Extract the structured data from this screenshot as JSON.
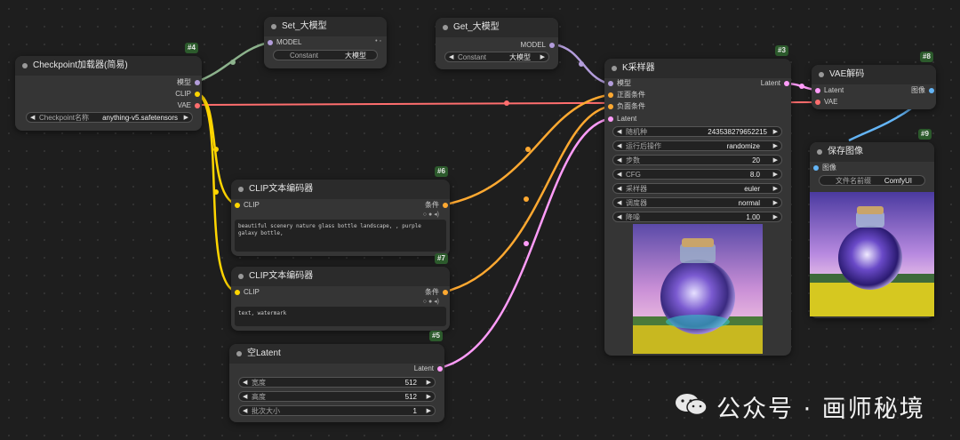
{
  "nodes": {
    "checkpoint": {
      "id": "#4",
      "title": "Checkpoint加载器(简易)",
      "outputs": [
        "模型",
        "CLIP",
        "VAE"
      ],
      "widget_label": "Checkpoint名称",
      "widget_value": "anything-v5.safetensors"
    },
    "set_model": {
      "title": "Set_大模型",
      "input": "MODEL",
      "widget_label": "Constant",
      "widget_value": "大模型"
    },
    "get_model": {
      "title": "Get_大模型",
      "output": "MODEL",
      "widget_label": "Constant",
      "widget_value": "大模型"
    },
    "clip_pos": {
      "id": "#6",
      "title": "CLIP文本编码器",
      "input": "CLIP",
      "output": "条件",
      "text": "beautiful scenery nature glass bottle landscape, , purple galaxy bottle,"
    },
    "clip_neg": {
      "id": "#7",
      "title": "CLIP文本编码器",
      "input": "CLIP",
      "output": "条件",
      "text": "text, watermark"
    },
    "empty_latent": {
      "id": "#5",
      "title": "空Latent",
      "output": "Latent",
      "widgets": [
        {
          "label": "宽度",
          "value": "512"
        },
        {
          "label": "高度",
          "value": "512"
        },
        {
          "label": "批次大小",
          "value": "1"
        }
      ]
    },
    "ksampler": {
      "id": "#3",
      "title": "K采样器",
      "inputs": [
        "模型",
        "正面条件",
        "负面条件",
        "Latent"
      ],
      "output": "Latent",
      "widgets": [
        {
          "label": "随机种",
          "value": "243538279652215"
        },
        {
          "label": "运行后操作",
          "value": "randomize"
        },
        {
          "label": "步数",
          "value": "20"
        },
        {
          "label": "CFG",
          "value": "8.0"
        },
        {
          "label": "采样器",
          "value": "euler"
        },
        {
          "label": "调度器",
          "value": "normal"
        },
        {
          "label": "降噪",
          "value": "1.00"
        }
      ]
    },
    "vae_decode": {
      "id": "#8",
      "title": "VAE解码",
      "inputs": [
        "Latent",
        "VAE"
      ],
      "output": "图像"
    },
    "save_image": {
      "id": "#9",
      "title": "保存图像",
      "input": "图像",
      "widget_label": "文件名前缀",
      "widget_value": "ComfyUI"
    }
  },
  "watermark": "公众号 · 画师秘境",
  "colors": {
    "model": "#b39ddb",
    "clip": "#ffd500",
    "vae": "#ff6e6e",
    "conditioning": "#ffa931",
    "latent": "#ff9cf9",
    "image": "#64b5f6",
    "link_green": "#8db38d"
  }
}
